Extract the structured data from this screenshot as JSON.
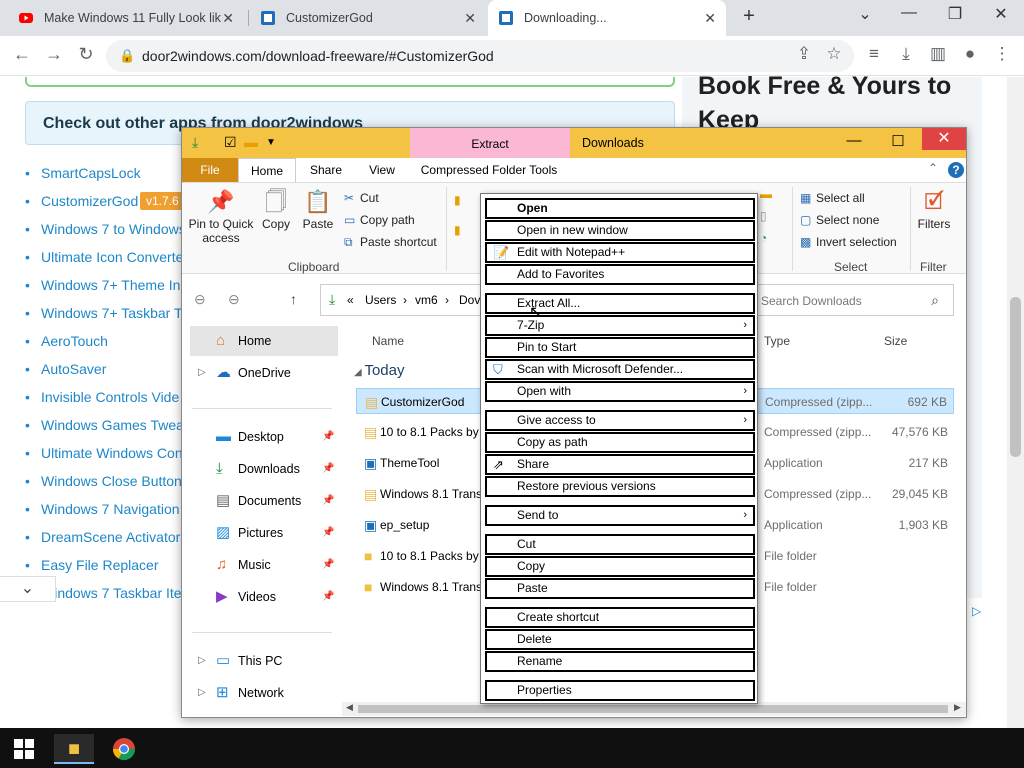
{
  "browser": {
    "tabs": [
      {
        "title": "Make Windows 11 Fully Look lik",
        "active": false
      },
      {
        "title": "CustomizerGod",
        "active": false
      },
      {
        "title": "Downloading...",
        "active": true
      }
    ],
    "url": "door2windows.com/download-freeware/#CustomizerGod"
  },
  "page": {
    "check_heading": "Check out other apps from door2windows",
    "links": [
      "SmartCapsLock",
      "CustomizerGod",
      "Windows 7 to Windows",
      "Ultimate Icon Converte",
      "Windows 7+ Theme Ins",
      "Windows 7+ Taskbar Tw",
      "AeroTouch",
      "AutoSaver",
      "Invisible Controls Vide",
      "Windows Games Tweak",
      "Ultimate Windows Con",
      "Windows Close Button",
      "Windows 7 Navigation",
      "DreamScene Activator",
      "Easy File Replacer",
      "Windows 7 Taskbar Ite"
    ],
    "version_badge": "v1.7.6",
    "book_text": "Book Free & Yours to Keep"
  },
  "explorer": {
    "title": "Downloads",
    "context_tab": "Extract",
    "ribbon_tabs": [
      "File",
      "Home",
      "Share",
      "View",
      "Compressed Folder Tools"
    ],
    "clipboard": {
      "pin": "Pin to Quick access",
      "copy": "Copy",
      "paste": "Paste",
      "cut": "Cut",
      "copy_path": "Copy path",
      "paste_shortcut": "Paste shortcut",
      "group": "Clipboard"
    },
    "select": {
      "all": "Select all",
      "none": "Select none",
      "invert": "Invert selection",
      "group": "Select"
    },
    "filter": {
      "label": "Filters",
      "group": "Filter"
    },
    "breadcrumb": [
      "«",
      "Users",
      "vm6",
      "Dov"
    ],
    "search_placeholder": "Search Downloads",
    "nav": {
      "home": "Home",
      "onedrive": "OneDrive",
      "desktop": "Desktop",
      "downloads": "Downloads",
      "documents": "Documents",
      "pictures": "Pictures",
      "music": "Music",
      "videos": "Videos",
      "thispc": "This PC",
      "network": "Network"
    },
    "columns": {
      "name": "Name",
      "type": "Type",
      "size": "Size"
    },
    "group_today": "Today",
    "files": [
      {
        "name": "CustomizerGod",
        "type": "Compressed (zipp...",
        "size": "692 KB",
        "icon": "zip-folder-icon"
      },
      {
        "name": "10 to 8.1 Packs by 2",
        "type": "Compressed (zipp...",
        "size": "47,576 KB",
        "icon": "zip-folder-icon"
      },
      {
        "name": "ThemeTool",
        "type": "Application",
        "size": "217 KB",
        "icon": "application-icon"
      },
      {
        "name": "Windows 8.1 Transf",
        "type": "Compressed (zipp...",
        "size": "29,045 KB",
        "icon": "zip-folder-icon"
      },
      {
        "name": "ep_setup",
        "type": "Application",
        "size": "1,903 KB",
        "icon": "application-icon"
      },
      {
        "name": "10 to 8.1 Packs by 2",
        "type": "File folder",
        "size": "",
        "icon": "folder-icon"
      },
      {
        "name": "Windows 8.1 Transf",
        "type": "File folder",
        "size": "",
        "icon": "folder-icon"
      }
    ]
  },
  "context_menu": {
    "items": [
      {
        "label": "Open",
        "bold": true,
        "submenu": false,
        "icon": ""
      },
      {
        "label": "Open in new window",
        "bold": false,
        "submenu": false,
        "icon": ""
      },
      {
        "label": "Edit with Notepad++",
        "bold": false,
        "submenu": false,
        "icon": "notepad-icon"
      },
      {
        "label": "Add to Favorites",
        "bold": false,
        "submenu": false,
        "icon": ""
      },
      {
        "label": "Extract All...",
        "bold": false,
        "submenu": false,
        "icon": ""
      },
      {
        "label": "7-Zip",
        "bold": false,
        "submenu": true,
        "icon": ""
      },
      {
        "label": "Pin to Start",
        "bold": false,
        "submenu": false,
        "icon": ""
      },
      {
        "label": "Scan with Microsoft Defender...",
        "bold": false,
        "submenu": false,
        "icon": "defender-icon"
      },
      {
        "label": "Open with",
        "bold": false,
        "submenu": true,
        "icon": ""
      },
      {
        "label": "Give access to",
        "bold": false,
        "submenu": true,
        "icon": ""
      },
      {
        "label": "Copy as path",
        "bold": false,
        "submenu": false,
        "icon": ""
      },
      {
        "label": "Share",
        "bold": false,
        "submenu": false,
        "icon": "share-icon"
      },
      {
        "label": "Restore previous versions",
        "bold": false,
        "submenu": false,
        "icon": ""
      },
      {
        "label": "Send to",
        "bold": false,
        "submenu": true,
        "icon": ""
      },
      {
        "label": "Cut",
        "bold": false,
        "submenu": false,
        "icon": ""
      },
      {
        "label": "Copy",
        "bold": false,
        "submenu": false,
        "icon": ""
      },
      {
        "label": "Paste",
        "bold": false,
        "submenu": false,
        "icon": ""
      },
      {
        "label": "Create shortcut",
        "bold": false,
        "submenu": false,
        "icon": ""
      },
      {
        "label": "Delete",
        "bold": false,
        "submenu": false,
        "icon": ""
      },
      {
        "label": "Rename",
        "bold": false,
        "submenu": false,
        "icon": ""
      },
      {
        "label": "Properties",
        "bold": false,
        "submenu": false,
        "icon": ""
      }
    ]
  },
  "colors": {
    "titlebar": "#f5c344",
    "file_tab": "#d08a14",
    "extract_tab": "#fbb8d4",
    "link": "#1e87c8",
    "close": "#e04343"
  }
}
